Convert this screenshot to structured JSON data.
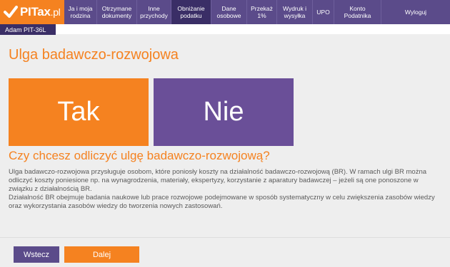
{
  "logo": {
    "brand": "PITax",
    "suffix": ".pl"
  },
  "nav": [
    {
      "label": "Ja i moja rodzina"
    },
    {
      "label": "Otrzymane dokumenty"
    },
    {
      "label": "Inne przychody"
    },
    {
      "label": "Obniżanie podatku"
    },
    {
      "label": "Dane osobowe"
    },
    {
      "label": "Przekaż 1%"
    },
    {
      "label": "Wydruk i wysyłka"
    },
    {
      "label": "UPO"
    },
    {
      "label": "Konto Podatnika"
    },
    {
      "label": "Wyloguj"
    }
  ],
  "user_tab": "Adam PIT-36L",
  "page_title": "Ulga badawczo-rozwojowa",
  "choices": {
    "yes": "Tak",
    "no": "Nie"
  },
  "question": "Czy chcesz odliczyć ulgę badawczo-rozwojową?",
  "description": [
    "Ulga badawczo-rozwojowa przysługuje osobom, które poniosły koszty na działalność badawczo-rozwojową (BR). W ramach ulgi BR można odliczyć koszty poniesione np. na wynagrodzenia, materiały, ekspertyzy, korzystanie z aparatury badawczej – jeżeli są one ponoszone w związku z działalnością BR.",
    "Działalność BR obejmuje badania naukowe lub prace rozwojowe podejmowane w sposób systematyczny w celu zwiększenia zasobów wiedzy oraz wykorzystania zasobów wiedzy do tworzenia nowych zastosowań."
  ],
  "buttons": {
    "back": "Wstecz",
    "next": "Dalej"
  },
  "colors": {
    "orange": "#f58220",
    "purple": "#5b4b8a",
    "dark_purple": "#3a2e66"
  }
}
